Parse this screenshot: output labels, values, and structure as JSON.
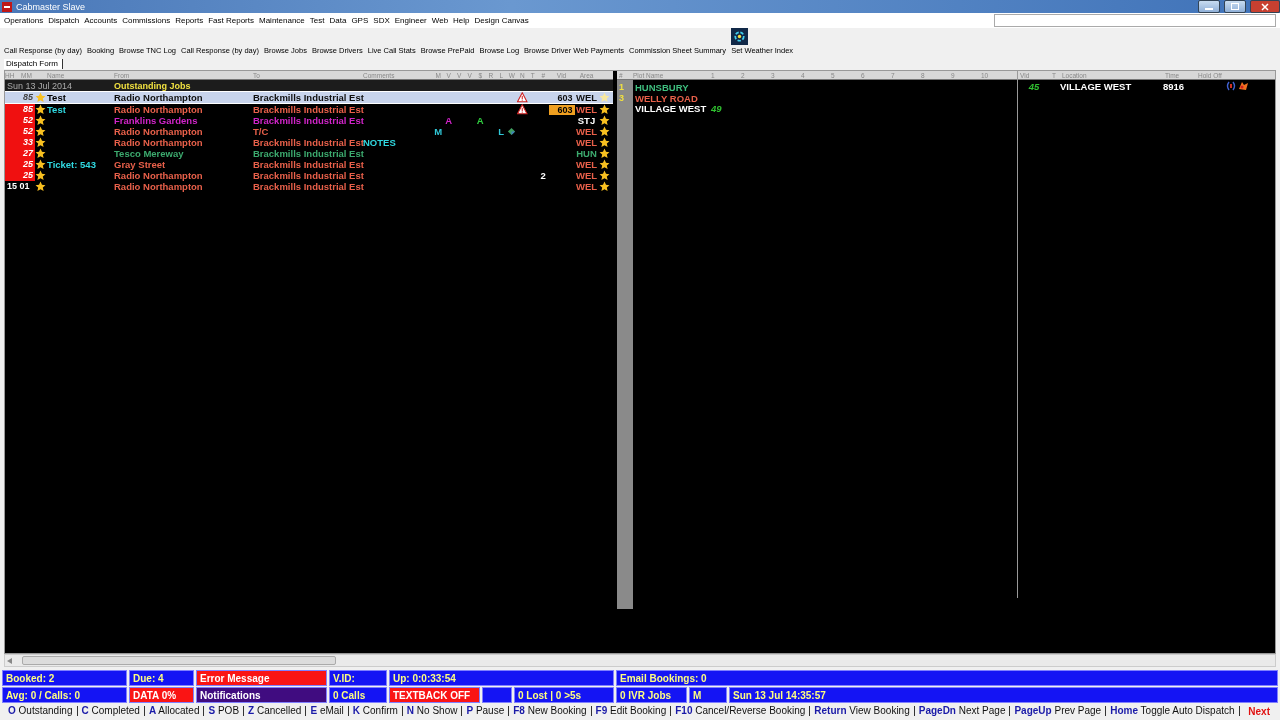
{
  "window": {
    "title": "Cabmaster Slave"
  },
  "menu": [
    "Operations",
    "Dispatch",
    "Accounts",
    "Commissions",
    "Reports",
    "Fast Reports",
    "Maintenance",
    "Test",
    "Data",
    "GPS",
    "SDX",
    "Engineer",
    "Web",
    "Help",
    "Design Canvas"
  ],
  "toolbar": [
    "Call Response (by day)",
    "Booking",
    "Browse TNC Log",
    "Call Response (by day)",
    "Browse Jobs",
    "Browse Drivers",
    "Live Call Stats",
    "Browse PrePaid",
    "Browse Log",
    "Browse Driver Web Payments",
    "Commission Sheet Summary",
    "Set Weather Index"
  ],
  "tabs": [
    {
      "label": "Dispatch Form",
      "selected": true
    }
  ],
  "jobs": {
    "columns": [
      "HH",
      "MM",
      "Name",
      "From",
      "To",
      "Comments",
      "M",
      "V",
      "V",
      "V",
      "$",
      "R",
      "L",
      "W",
      "N",
      "T",
      "#",
      "Vld",
      "Area"
    ],
    "date": "Sun 13 Jul 2014",
    "section": "Outstanding Jobs",
    "rows": [
      {
        "time": "85",
        "overdue": false,
        "selected": true,
        "name": "Test",
        "from": "Radio Northampton",
        "to": "Brackmills Industrial Est",
        "color": "#101010",
        "flags": {},
        "n_warning": true,
        "vid": "603",
        "vid_highlight": false,
        "area": "WEL"
      },
      {
        "time": "85",
        "overdue": true,
        "selected": false,
        "name": "Test",
        "from": "Radio Northampton",
        "to": "Brackmills Industrial Est",
        "color": "#e8604a",
        "flags": {},
        "n_warning": true,
        "vid": "603",
        "vid_highlight": true,
        "area": "WEL"
      },
      {
        "time": "52",
        "overdue": true,
        "selected": false,
        "from": "Franklins Gardens",
        "to": "Brackmills Industrial Est",
        "color": "#d024c8",
        "flags": {
          "v_1": {
            "text": "A",
            "color": "#d024c8"
          },
          "dollar": {
            "text": "A",
            "color": "#30d040"
          }
        },
        "area": "STJ",
        "area_white": true
      },
      {
        "time": "52",
        "overdue": true,
        "selected": false,
        "from": "Radio Northampton",
        "to": "T/C",
        "color": "#e8604a",
        "flags": {
          "m": {
            "text": "M",
            "color": "#30c8d8"
          },
          "l": {
            "text": "L",
            "color": "#30c8d8"
          }
        },
        "w_icon": true,
        "area": "WEL"
      },
      {
        "time": "33",
        "overdue": true,
        "selected": false,
        "from": "Radio Northampton",
        "to": "Brackmills Industrial Est",
        "comments": "NOTES",
        "color": "#e8604a",
        "flags": {},
        "area": "WEL"
      },
      {
        "time": "27",
        "overdue": true,
        "selected": false,
        "from": "Tesco Mereway",
        "to": "Brackmills Industrial Est",
        "color": "#3caa6e",
        "flags": {},
        "area": "HUN"
      },
      {
        "time": "25",
        "overdue": true,
        "selected": false,
        "name": "Ticket: 543",
        "from": "Gray Street",
        "to": "Brackmills Industrial Est",
        "color": "#e8604a",
        "flags": {},
        "area": "WEL"
      },
      {
        "time": "25",
        "overdue": true,
        "selected": false,
        "from": "Radio Northampton",
        "to": "Brackmills Industrial Est",
        "color": "#e8604a",
        "flags": {
          "hash": {
            "text": "2",
            "color": "#ffffff"
          }
        },
        "area": "WEL"
      },
      {
        "time": "15 01",
        "overdue": false,
        "selected": false,
        "from": "Radio Northampton",
        "to": "Brackmills Industrial Est",
        "color": "#e8604a",
        "flags": {},
        "area": "WEL"
      }
    ]
  },
  "plots": {
    "columns": [
      "#",
      "Plot Name",
      "1",
      "2",
      "3",
      "4",
      "5",
      "6",
      "7",
      "8",
      "9",
      "10"
    ],
    "rows": [
      {
        "number": "1",
        "name": "HUNSBURY",
        "color": "#3fbf7f"
      },
      {
        "number": "3",
        "name": "WELLY ROAD",
        "color": "#e8604a"
      },
      {
        "name": "VILLAGE WEST",
        "color": "#ffffff",
        "vehicles": [
          "49"
        ]
      }
    ]
  },
  "drivers": {
    "columns": [
      "Vld",
      "T",
      "Location",
      "Time",
      "Hold Off"
    ],
    "rows": [
      {
        "vid": "45",
        "location": "VILLAGE WEST",
        "time": "8916"
      }
    ]
  },
  "status_rows": [
    [
      {
        "text": "Booked: 2",
        "kind": "info"
      },
      {
        "text": "Due: 4",
        "kind": "info"
      },
      {
        "text": "Error Message",
        "kind": "alert"
      },
      {
        "text": "V.ID:",
        "kind": "info"
      },
      {
        "text": "Up: 0:0:33:54",
        "kind": "info"
      },
      {
        "text": "Email Bookings: 0",
        "kind": "info"
      }
    ],
    [
      {
        "text": "Avg: 0 / Calls: 0",
        "kind": "info"
      },
      {
        "text": "DATA 0%",
        "kind": "alert"
      },
      {
        "text": "Notifications",
        "kind": "notice"
      },
      {
        "text": "0 Calls",
        "kind": "info"
      },
      {
        "text": "TEXTBACK OFF",
        "kind": "alert"
      },
      {
        "kind": "info"
      },
      {
        "text": "0 Lost | 0 >5s",
        "kind": "info"
      },
      {
        "text": "0 IVR Jobs",
        "kind": "info"
      },
      {
        "text": "M",
        "kind": "info"
      },
      {
        "text": "Sun 13 Jul 14:35:57",
        "kind": "info"
      }
    ]
  ],
  "hotkeys": [
    {
      "key": "O",
      "label": "Outstanding"
    },
    {
      "key": "C",
      "label": "Completed"
    },
    {
      "key": "A",
      "label": "Allocated"
    },
    {
      "key": "S",
      "label": "POB"
    },
    {
      "key": "Z",
      "label": "Cancelled"
    },
    {
      "key": "E",
      "label": "eMail"
    },
    {
      "key": "K",
      "label": "Confirm"
    },
    {
      "key": "N",
      "label": "No Show"
    },
    {
      "key": "P",
      "label": "Pause"
    },
    {
      "key": "F8",
      "label": "New Booking"
    },
    {
      "key": "F9",
      "label": "Edit Booking"
    },
    {
      "key": "F10",
      "label": "Cancel/Reverse Booking"
    },
    {
      "key": "Return",
      "label": "View Booking"
    },
    {
      "key": "PageDn",
      "label": "Next Page"
    },
    {
      "key": "PageUp",
      "label": "Prev Page"
    },
    {
      "key": "Home",
      "label": "Toggle Auto Dispatch"
    }
  ],
  "next": "Next"
}
